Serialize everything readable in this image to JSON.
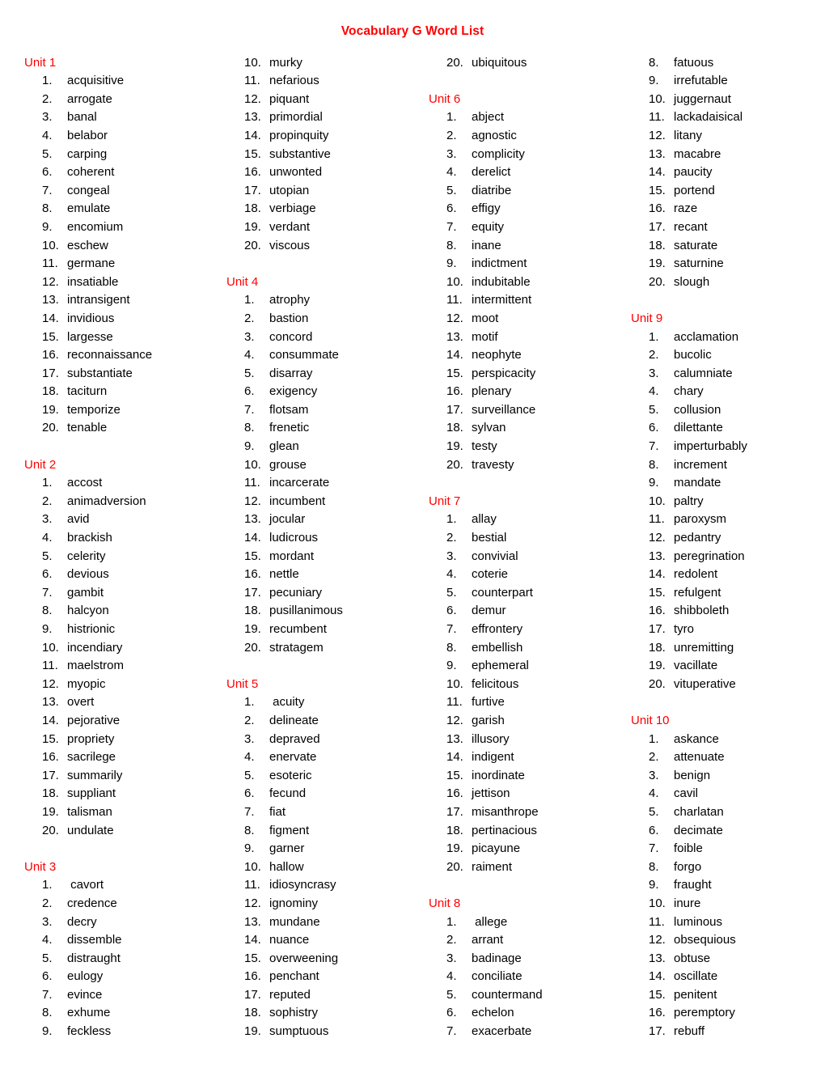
{
  "document": {
    "title": "Vocabulary G Word List",
    "title_color": "#ff0000",
    "unit_heading_color": "#ff0000",
    "body_color": "#000000"
  },
  "columns": [
    {
      "name": "column-1",
      "blocks": [
        {
          "type": "unit",
          "heading": "Unit 1",
          "items": [
            {
              "num": "1.",
              "word": "acquisitive"
            },
            {
              "num": "2.",
              "word": "arrogate"
            },
            {
              "num": "3.",
              "word": "banal"
            },
            {
              "num": "4.",
              "word": "belabor"
            },
            {
              "num": "5.",
              "word": "carping"
            },
            {
              "num": "6.",
              "word": "coherent"
            },
            {
              "num": "7.",
              "word": "congeal"
            },
            {
              "num": "8.",
              "word": "emulate"
            },
            {
              "num": "9.",
              "word": "encomium"
            },
            {
              "num": "10.",
              "word": "eschew"
            },
            {
              "num": "11.",
              "word": "germane"
            },
            {
              "num": "12.",
              "word": "insatiable"
            },
            {
              "num": "13.",
              "word": "intransigent"
            },
            {
              "num": "14.",
              "word": "invidious"
            },
            {
              "num": "15.",
              "word": "largesse"
            },
            {
              "num": "16.",
              "word": "reconnaissance"
            },
            {
              "num": "17.",
              "word": "substantiate"
            },
            {
              "num": "18.",
              "word": "taciturn"
            },
            {
              "num": "19.",
              "word": "temporize"
            },
            {
              "num": "20.",
              "word": "tenable"
            }
          ]
        },
        {
          "type": "unit",
          "heading": "Unit 2",
          "items": [
            {
              "num": "1.",
              "word": "accost"
            },
            {
              "num": "2.",
              "word": "animadversion"
            },
            {
              "num": "3.",
              "word": "avid"
            },
            {
              "num": "4.",
              "word": "brackish"
            },
            {
              "num": "5.",
              "word": "celerity"
            },
            {
              "num": "6.",
              "word": "devious"
            },
            {
              "num": "7.",
              "word": "gambit"
            },
            {
              "num": "8.",
              "word": "halcyon"
            },
            {
              "num": "9.",
              "word": "histrionic"
            },
            {
              "num": "10.",
              "word": "incendiary"
            },
            {
              "num": "11.",
              "word": "maelstrom"
            },
            {
              "num": "12.",
              "word": "myopic"
            },
            {
              "num": "13.",
              "word": "overt"
            },
            {
              "num": "14.",
              "word": "pejorative"
            },
            {
              "num": "15.",
              "word": "propriety"
            },
            {
              "num": "16.",
              "word": "sacrilege"
            },
            {
              "num": "17.",
              "word": "summarily"
            },
            {
              "num": "18.",
              "word": "suppliant"
            },
            {
              "num": "19.",
              "word": "talisman"
            },
            {
              "num": "20.",
              "word": "undulate"
            }
          ]
        },
        {
          "type": "unit",
          "heading": "Unit 3",
          "items": [
            {
              "num": "1.",
              "word": " cavort"
            },
            {
              "num": "2.",
              "word": "credence"
            },
            {
              "num": "3.",
              "word": "decry"
            },
            {
              "num": "4.",
              "word": "dissemble"
            },
            {
              "num": "5.",
              "word": "distraught"
            },
            {
              "num": "6.",
              "word": "eulogy"
            },
            {
              "num": "7.",
              "word": "evince"
            },
            {
              "num": "8.",
              "word": "exhume"
            },
            {
              "num": "9.",
              "word": "feckless"
            }
          ]
        }
      ]
    },
    {
      "name": "column-2",
      "blocks": [
        {
          "type": "continuation",
          "heading": "",
          "items": [
            {
              "num": "10.",
              "word": "murky"
            },
            {
              "num": "11.",
              "word": "nefarious"
            },
            {
              "num": "12.",
              "word": "piquant"
            },
            {
              "num": "13.",
              "word": "primordial"
            },
            {
              "num": "14.",
              "word": "propinquity"
            },
            {
              "num": "15.",
              "word": "substantive"
            },
            {
              "num": "16.",
              "word": "unwonted"
            },
            {
              "num": "17.",
              "word": "utopian"
            },
            {
              "num": "18.",
              "word": "verbiage"
            },
            {
              "num": "19.",
              "word": "verdant"
            },
            {
              "num": "20.",
              "word": "viscous"
            }
          ]
        },
        {
          "type": "unit",
          "heading": "Unit 4",
          "items": [
            {
              "num": "1.",
              "word": "atrophy"
            },
            {
              "num": "2.",
              "word": "bastion"
            },
            {
              "num": "3.",
              "word": "concord"
            },
            {
              "num": "4.",
              "word": "consummate"
            },
            {
              "num": "5.",
              "word": "disarray"
            },
            {
              "num": "6.",
              "word": "exigency"
            },
            {
              "num": "7.",
              "word": "flotsam"
            },
            {
              "num": "8.",
              "word": "frenetic"
            },
            {
              "num": "9.",
              "word": "glean"
            },
            {
              "num": "10.",
              "word": "grouse"
            },
            {
              "num": "11.",
              "word": "incarcerate"
            },
            {
              "num": "12.",
              "word": "incumbent"
            },
            {
              "num": "13.",
              "word": "jocular"
            },
            {
              "num": "14.",
              "word": "ludicrous"
            },
            {
              "num": "15.",
              "word": "mordant"
            },
            {
              "num": "16.",
              "word": "nettle"
            },
            {
              "num": "17.",
              "word": "pecuniary"
            },
            {
              "num": "18.",
              "word": "pusillanimous"
            },
            {
              "num": "19.",
              "word": "recumbent"
            },
            {
              "num": "20.",
              "word": "stratagem"
            }
          ]
        },
        {
          "type": "unit",
          "heading": "Unit 5",
          "items": [
            {
              "num": "1.",
              "word": " acuity"
            },
            {
              "num": "2.",
              "word": "delineate"
            },
            {
              "num": "3.",
              "word": "depraved"
            },
            {
              "num": "4.",
              "word": "enervate"
            },
            {
              "num": "5.",
              "word": "esoteric"
            },
            {
              "num": "6.",
              "word": "fecund"
            },
            {
              "num": "7.",
              "word": "fiat"
            },
            {
              "num": "8.",
              "word": "figment"
            },
            {
              "num": "9.",
              "word": "garner"
            },
            {
              "num": "10.",
              "word": "hallow"
            },
            {
              "num": "11.",
              "word": "idiosyncrasy"
            },
            {
              "num": "12.",
              "word": "ignominy"
            },
            {
              "num": "13.",
              "word": "mundane"
            },
            {
              "num": "14.",
              "word": "nuance"
            },
            {
              "num": "15.",
              "word": "overweening"
            },
            {
              "num": "16.",
              "word": "penchant"
            },
            {
              "num": "17.",
              "word": "reputed"
            },
            {
              "num": "18.",
              "word": "sophistry"
            },
            {
              "num": "19.",
              "word": "sumptuous"
            }
          ]
        }
      ]
    },
    {
      "name": "column-3",
      "blocks": [
        {
          "type": "continuation",
          "heading": "",
          "items": [
            {
              "num": "20.",
              "word": "ubiquitous"
            }
          ]
        },
        {
          "type": "unit",
          "heading": "Unit 6",
          "items": [
            {
              "num": "1.",
              "word": "abject"
            },
            {
              "num": "2.",
              "word": "agnostic"
            },
            {
              "num": "3.",
              "word": "complicity"
            },
            {
              "num": "4.",
              "word": "derelict"
            },
            {
              "num": "5.",
              "word": "diatribe"
            },
            {
              "num": "6.",
              "word": "effigy"
            },
            {
              "num": "7.",
              "word": "equity"
            },
            {
              "num": "8.",
              "word": "inane"
            },
            {
              "num": "9.",
              "word": "indictment"
            },
            {
              "num": "10.",
              "word": "indubitable"
            },
            {
              "num": "11.",
              "word": "intermittent"
            },
            {
              "num": "12.",
              "word": "moot"
            },
            {
              "num": "13.",
              "word": "motif"
            },
            {
              "num": "14.",
              "word": "neophyte"
            },
            {
              "num": "15.",
              "word": "perspicacity"
            },
            {
              "num": "16.",
              "word": "plenary"
            },
            {
              "num": "17.",
              "word": "surveillance"
            },
            {
              "num": "18.",
              "word": "sylvan"
            },
            {
              "num": "19.",
              "word": "testy"
            },
            {
              "num": "20.",
              "word": "travesty"
            }
          ]
        },
        {
          "type": "unit",
          "heading": "Unit 7",
          "items": [
            {
              "num": "1.",
              "word": "allay"
            },
            {
              "num": "2.",
              "word": "bestial"
            },
            {
              "num": "3.",
              "word": "convivial"
            },
            {
              "num": "4.",
              "word": "coterie"
            },
            {
              "num": "5.",
              "word": "counterpart"
            },
            {
              "num": "6.",
              "word": "demur"
            },
            {
              "num": "7.",
              "word": "effrontery"
            },
            {
              "num": "8.",
              "word": "embellish"
            },
            {
              "num": "9.",
              "word": "ephemeral"
            },
            {
              "num": "10.",
              "word": "felicitous"
            },
            {
              "num": "11.",
              "word": "furtive"
            },
            {
              "num": "12.",
              "word": "garish"
            },
            {
              "num": "13.",
              "word": "illusory"
            },
            {
              "num": "14.",
              "word": "indigent"
            },
            {
              "num": "15.",
              "word": "inordinate"
            },
            {
              "num": "16.",
              "word": "jettison"
            },
            {
              "num": "17.",
              "word": "misanthrope"
            },
            {
              "num": "18.",
              "word": "pertinacious"
            },
            {
              "num": "19.",
              "word": "picayune"
            },
            {
              "num": "20.",
              "word": "raiment"
            }
          ]
        },
        {
          "type": "unit",
          "heading": "Unit 8",
          "items": [
            {
              "num": "1.",
              "word": " allege"
            },
            {
              "num": "2.",
              "word": "arrant"
            },
            {
              "num": "3.",
              "word": "badinage"
            },
            {
              "num": "4.",
              "word": "conciliate"
            },
            {
              "num": "5.",
              "word": "countermand"
            },
            {
              "num": "6.",
              "word": "echelon"
            },
            {
              "num": "7.",
              "word": "exacerbate"
            }
          ]
        }
      ]
    },
    {
      "name": "column-4",
      "blocks": [
        {
          "type": "continuation",
          "heading": "",
          "items": [
            {
              "num": "8.",
              "word": "fatuous"
            },
            {
              "num": "9.",
              "word": "irrefutable"
            },
            {
              "num": "10.",
              "word": "juggernaut"
            },
            {
              "num": "11.",
              "word": "lackadaisical"
            },
            {
              "num": "12.",
              "word": "litany"
            },
            {
              "num": "13.",
              "word": "macabre"
            },
            {
              "num": "14.",
              "word": "paucity"
            },
            {
              "num": "15.",
              "word": "portend"
            },
            {
              "num": "16.",
              "word": "raze"
            },
            {
              "num": "17.",
              "word": "recant"
            },
            {
              "num": "18.",
              "word": "saturate"
            },
            {
              "num": "19.",
              "word": "saturnine"
            },
            {
              "num": "20.",
              "word": "slough"
            }
          ]
        },
        {
          "type": "unit",
          "heading": "Unit 9",
          "items": [
            {
              "num": "1.",
              "word": "acclamation"
            },
            {
              "num": "2.",
              "word": "bucolic"
            },
            {
              "num": "3.",
              "word": "calumniate"
            },
            {
              "num": "4.",
              "word": "chary"
            },
            {
              "num": "5.",
              "word": "collusion"
            },
            {
              "num": "6.",
              "word": "dilettante"
            },
            {
              "num": "7.",
              "word": "imperturbably"
            },
            {
              "num": "8.",
              "word": "increment"
            },
            {
              "num": "9.",
              "word": "mandate"
            },
            {
              "num": "10.",
              "word": "paltry"
            },
            {
              "num": "11.",
              "word": "paroxysm"
            },
            {
              "num": "12.",
              "word": "pedantry"
            },
            {
              "num": "13.",
              "word": "peregrination"
            },
            {
              "num": "14.",
              "word": "redolent"
            },
            {
              "num": "15.",
              "word": "refulgent"
            },
            {
              "num": "16.",
              "word": "shibboleth"
            },
            {
              "num": "17.",
              "word": "tyro"
            },
            {
              "num": "18.",
              "word": "unremitting"
            },
            {
              "num": "19.",
              "word": "vacillate"
            },
            {
              "num": "20.",
              "word": "vituperative"
            }
          ]
        },
        {
          "type": "unit",
          "heading": "Unit 10",
          "items": [
            {
              "num": "1.",
              "word": "askance"
            },
            {
              "num": "2.",
              "word": "attenuate"
            },
            {
              "num": "3.",
              "word": "benign"
            },
            {
              "num": "4.",
              "word": "cavil"
            },
            {
              "num": "5.",
              "word": "charlatan"
            },
            {
              "num": "6.",
              "word": "decimate"
            },
            {
              "num": "7.",
              "word": "foible"
            },
            {
              "num": "8.",
              "word": "forgo"
            },
            {
              "num": "9.",
              "word": "fraught"
            },
            {
              "num": "10.",
              "word": "inure"
            },
            {
              "num": "11.",
              "word": "luminous"
            },
            {
              "num": "12.",
              "word": "obsequious"
            },
            {
              "num": "13.",
              "word": "obtuse"
            },
            {
              "num": "14.",
              "word": "oscillate"
            },
            {
              "num": "15.",
              "word": "penitent"
            },
            {
              "num": "16.",
              "word": "peremptory"
            },
            {
              "num": "17.",
              "word": "rebuff"
            }
          ]
        }
      ]
    }
  ]
}
